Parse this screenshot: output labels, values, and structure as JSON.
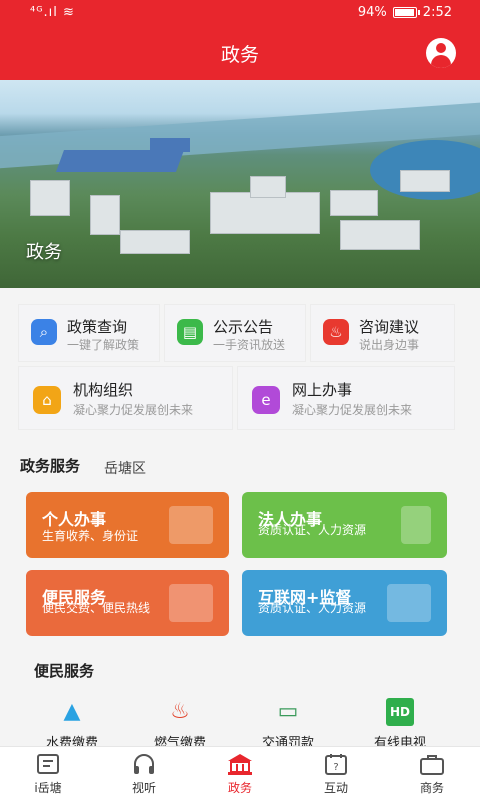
{
  "status_bar": {
    "signal": "⁴ᴳ.ıl ≋",
    "battery": "94%",
    "battery_level": 0.94,
    "time": "2:52"
  },
  "header": {
    "title": "政务",
    "user_icon": "user-circle-icon"
  },
  "banner": {
    "label": "政务"
  },
  "quick_links": [
    {
      "title": "政策查询",
      "subtitle": "一键了解政策",
      "icon": "search-icon",
      "color": "#3b82e6"
    },
    {
      "title": "公示公告",
      "subtitle": "一手资讯放送",
      "icon": "shop-icon",
      "color": "#3cb94a"
    },
    {
      "title": "咨询建议",
      "subtitle": "说出身边事",
      "icon": "flame-icon",
      "color": "#e8392f"
    },
    {
      "title": "机构组织",
      "subtitle": "凝心聚力促发展创未来",
      "icon": "building-icon",
      "color": "#f2a516"
    },
    {
      "title": "网上办事",
      "subtitle": "凝心聚力促发展创未来",
      "icon": "ie-icon",
      "color": "#b14ad8"
    }
  ],
  "gov_services": {
    "title": "政务服务",
    "district": "岳塘区",
    "cards": [
      {
        "title": "个人办事",
        "subtitle": "生育收养、身份证",
        "color": "#e8732e"
      },
      {
        "title": "法人办事",
        "subtitle": "资质认证、人力资源",
        "color": "#6cc04a"
      },
      {
        "title": "便民服务",
        "subtitle": "便民交费、便民热线",
        "color": "#ea6a3c"
      },
      {
        "title": "互联网+监督",
        "subtitle": "资质认证、人力资源",
        "color": "#3f9fd6"
      }
    ]
  },
  "convenience": {
    "title": "便民服务",
    "items": [
      {
        "label": "水费缴费",
        "icon": "water-drop-icon",
        "color": "#2aa2e2"
      },
      {
        "label": "燃气缴费",
        "icon": "gas-flame-icon",
        "color": "#e2442c"
      },
      {
        "label": "交通罚款",
        "icon": "car-icon",
        "color": "#3a9a5a"
      },
      {
        "label": "有线电视",
        "icon": "hd-tv-icon",
        "color": "#2fae4c"
      }
    ]
  },
  "bottom_nav": [
    {
      "label": "i岳塘",
      "icon": "news-icon",
      "active": false
    },
    {
      "label": "视听",
      "icon": "headphones-icon",
      "active": false
    },
    {
      "label": "政务",
      "icon": "government-icon",
      "active": true
    },
    {
      "label": "互动",
      "icon": "calendar-question-icon",
      "active": false
    },
    {
      "label": "商务",
      "icon": "briefcase-icon",
      "active": false
    }
  ]
}
